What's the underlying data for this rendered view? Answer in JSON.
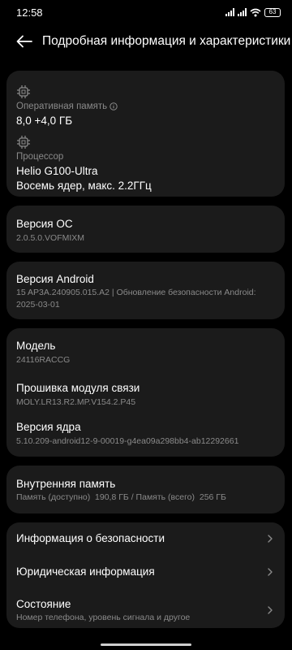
{
  "status_bar": {
    "time": "12:58",
    "battery": "63"
  },
  "header": {
    "title": "Подробная информация и характеристики"
  },
  "hardware": {
    "ram_label": "Оперативная память",
    "ram_value": "8,0 +4,0 ГБ",
    "cpu_label": "Процессор",
    "cpu_value": "Helio G100-Ultra",
    "cpu_detail": "Восемь ядер, макс. 2.2ГГц"
  },
  "os": {
    "label": "Версия ОС",
    "value": "2.0.5.0.VOFMIXM"
  },
  "android": {
    "label": "Версия Android",
    "value": "15 AP3A.240905.015.A2 | Обновление безопасности Android: 2025-03-01"
  },
  "device": {
    "model_label": "Модель",
    "model_value": "24116RACCG",
    "baseband_label": "Прошивка модуля связи",
    "baseband_value": "MOLY.LR13.R2.MP.V154.2.P45",
    "kernel_label": "Версия ядра",
    "kernel_value": "5.10.209-android12-9-00019-g4ea09a298bb4-ab12292661"
  },
  "storage": {
    "label": "Внутренняя память",
    "value": "Память (доступно)  190,8 ГБ / Память (всего)  256 ГБ"
  },
  "links": {
    "security": "Информация о безопасности",
    "legal": "Юридическая информация",
    "status": "Состояние",
    "status_sub": "Номер телефона, уровень сигнала и другое"
  }
}
